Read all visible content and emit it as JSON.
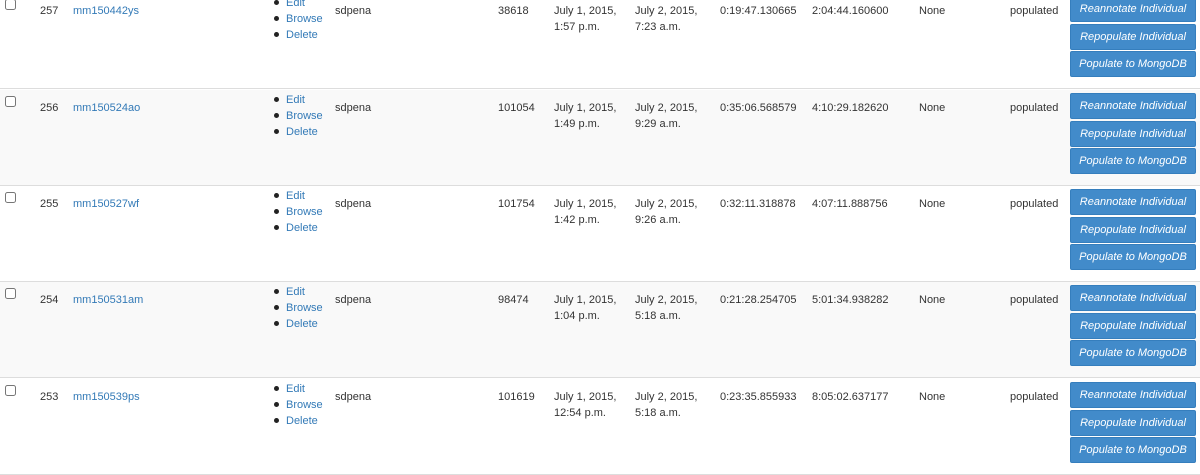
{
  "rows": [
    {
      "id": "257",
      "name": "mm150442ys",
      "actions": [
        "Edit",
        "Browse",
        "Delete"
      ],
      "user": "sdpena",
      "count": "38618",
      "start": [
        "July 1, 2015,",
        "1:57 p.m."
      ],
      "end": [
        "July 2, 2015,",
        "7:23 a.m."
      ],
      "duration1": "0:19:47.130665",
      "duration2": "2:04:44.160600",
      "extra": "None",
      "status": "populated",
      "buttons": [
        "Reannotate Individual",
        "Repopulate Individual",
        "Populate to MongoDB"
      ]
    },
    {
      "id": "256",
      "name": "mm150524ao",
      "actions": [
        "Edit",
        "Browse",
        "Delete"
      ],
      "user": "sdpena",
      "count": "101054",
      "start": [
        "July 1, 2015,",
        "1:49 p.m."
      ],
      "end": [
        "July 2, 2015,",
        "9:29 a.m."
      ],
      "duration1": "0:35:06.568579",
      "duration2": "4:10:29.182620",
      "extra": "None",
      "status": "populated",
      "buttons": [
        "Reannotate Individual",
        "Repopulate Individual",
        "Populate to MongoDB"
      ]
    },
    {
      "id": "255",
      "name": "mm150527wf",
      "actions": [
        "Edit",
        "Browse",
        "Delete"
      ],
      "user": "sdpena",
      "count": "101754",
      "start": [
        "July 1, 2015,",
        "1:42 p.m."
      ],
      "end": [
        "July 2, 2015,",
        "9:26 a.m."
      ],
      "duration1": "0:32:11.318878",
      "duration2": "4:07:11.888756",
      "extra": "None",
      "status": "populated",
      "buttons": [
        "Reannotate Individual",
        "Repopulate Individual",
        "Populate to MongoDB"
      ]
    },
    {
      "id": "254",
      "name": "mm150531am",
      "actions": [
        "Edit",
        "Browse",
        "Delete"
      ],
      "user": "sdpena",
      "count": "98474",
      "start": [
        "July 1, 2015,",
        "1:04 p.m."
      ],
      "end": [
        "July 2, 2015,",
        "5:18 a.m."
      ],
      "duration1": "0:21:28.254705",
      "duration2": "5:01:34.938282",
      "extra": "None",
      "status": "populated",
      "buttons": [
        "Reannotate Individual",
        "Repopulate Individual",
        "Populate to MongoDB"
      ]
    },
    {
      "id": "253",
      "name": "mm150539ps",
      "actions": [
        "Edit",
        "Browse",
        "Delete"
      ],
      "user": "sdpena",
      "count": "101619",
      "start": [
        "July 1, 2015,",
        "12:54 p.m."
      ],
      "end": [
        "July 2, 2015,",
        "5:18 a.m."
      ],
      "duration1": "0:23:35.855933",
      "duration2": "8:05:02.637177",
      "extra": "None",
      "status": "populated",
      "buttons": [
        "Reannotate Individual",
        "Repopulate Individual",
        "Populate to MongoDB"
      ]
    }
  ],
  "colors": {
    "link": "#337ab7",
    "button": "#428bca",
    "row_alt": "#f9f9f9"
  }
}
